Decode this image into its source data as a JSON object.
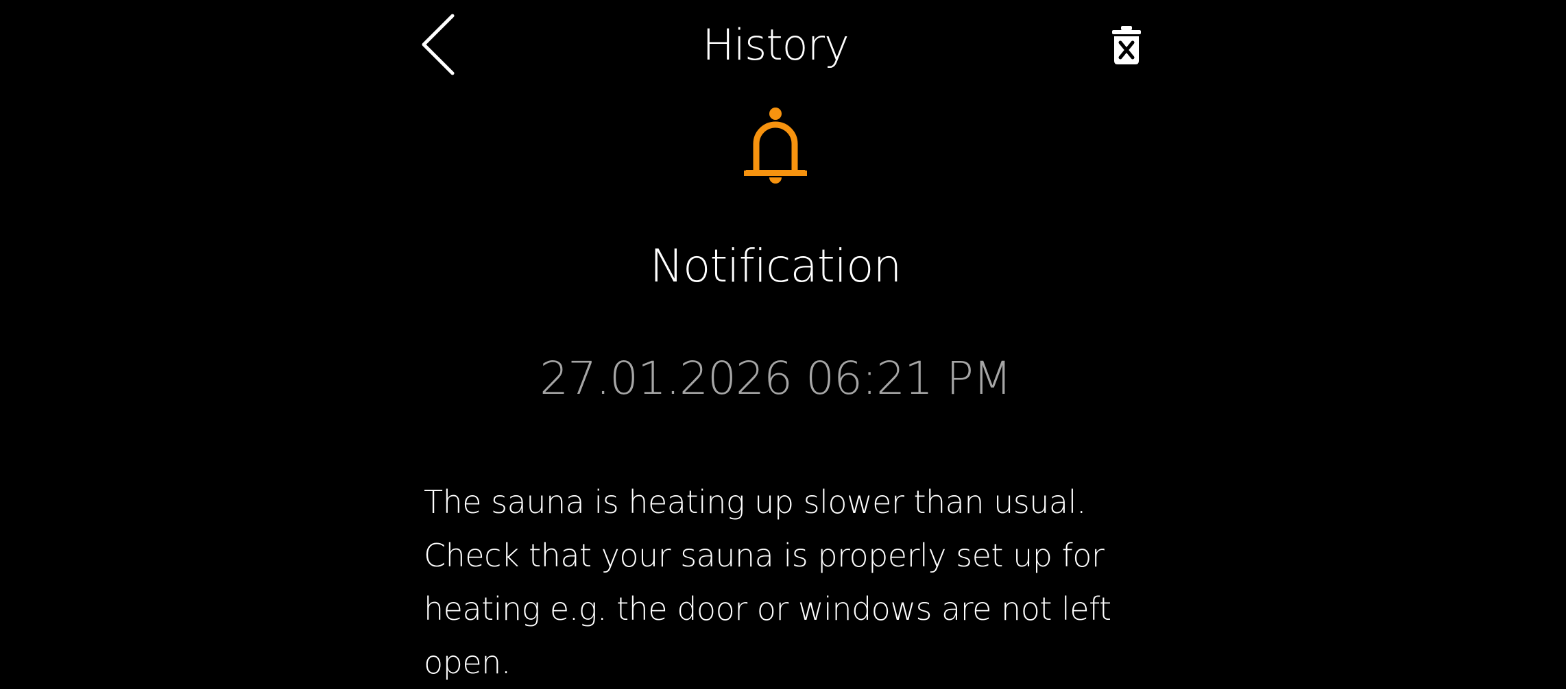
{
  "header": {
    "title": "History",
    "back_icon": "chevron-left-icon",
    "delete_icon": "trash-icon"
  },
  "notification": {
    "icon": "bell-icon",
    "icon_color": "#f7930f",
    "type_label": "Notification",
    "timestamp": "27.01.2026 06:21 PM",
    "message": "The sauna is heating up slower than usual. Check that your sauna is properly set up for heating e.g. the door or windows are not left open."
  },
  "colors": {
    "background": "#000000",
    "text_primary": "#ffffff",
    "text_secondary": "#a6a6a6"
  }
}
